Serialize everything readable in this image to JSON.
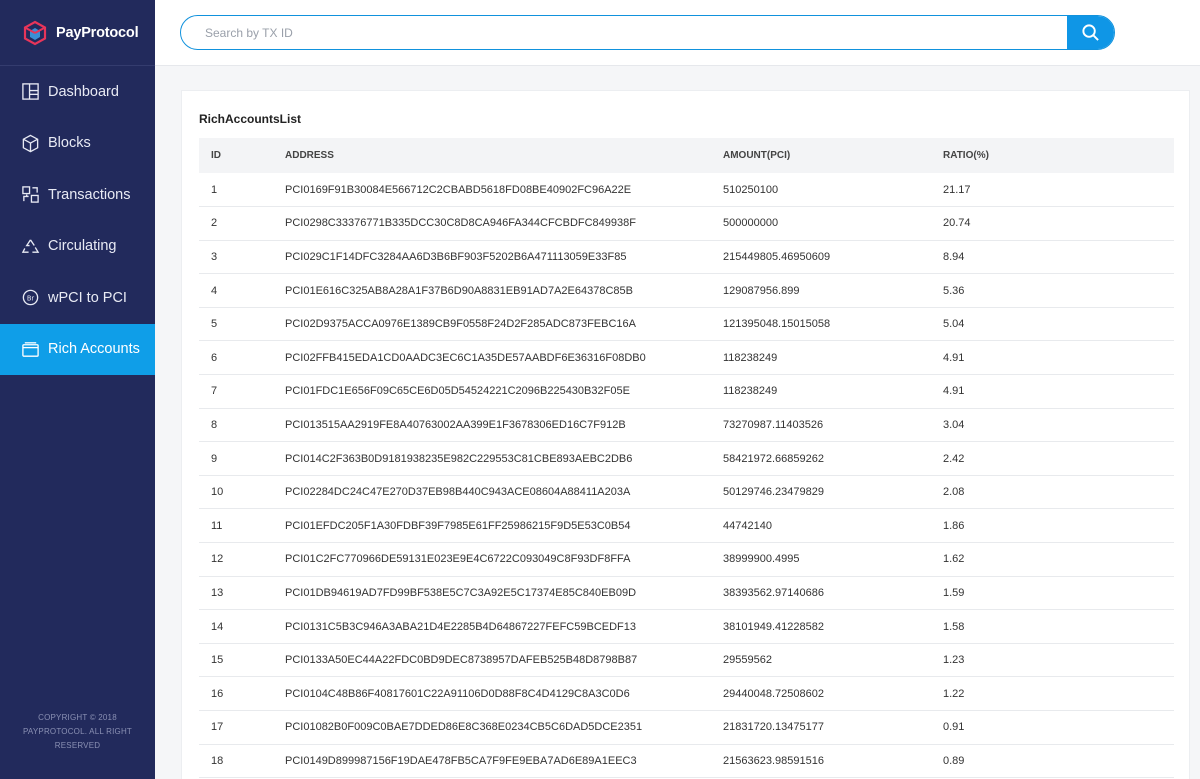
{
  "brand": {
    "name": "PayProtocol"
  },
  "sidebar": {
    "items": [
      {
        "label": "Dashboard",
        "icon": "dashboard-icon"
      },
      {
        "label": "Blocks",
        "icon": "cube-icon"
      },
      {
        "label": "Transactions",
        "icon": "transactions-icon"
      },
      {
        "label": "Circulating",
        "icon": "circulating-icon"
      },
      {
        "label": "wPCI to PCI",
        "icon": "coin-icon"
      },
      {
        "label": "Rich Accounts",
        "icon": "wallet-icon",
        "active": true
      }
    ],
    "copyright": [
      "COPYRIGHT © 2018",
      "PAYPROTOCOL. ALL RIGHT",
      "RESERVED"
    ]
  },
  "search": {
    "placeholder": "Search by TX ID",
    "value": ""
  },
  "main": {
    "title": "RichAccountsList",
    "columns": [
      "ID",
      "ADDRESS",
      "AMOUNT(PCI)",
      "RATIO(%)"
    ],
    "rows": [
      [
        "1",
        "PCI0169F91B30084E566712C2CBABD5618FD08BE40902FC96A22E",
        "510250100",
        "21.17"
      ],
      [
        "2",
        "PCI0298C33376771B335DCC30C8D8CA946FA344CFCBDFC849938F",
        "500000000",
        "20.74"
      ],
      [
        "3",
        "PCI029C1F14DFC3284AA6D3B6BF903F5202B6A471113059E33F85",
        "215449805.46950609",
        "8.94"
      ],
      [
        "4",
        "PCI01E616C325AB8A28A1F37B6D90A8831EB91AD7A2E64378C85B",
        "129087956.899",
        "5.36"
      ],
      [
        "5",
        "PCI02D9375ACCA0976E1389CB9F0558F24D2F285ADC873FEBC16A",
        "121395048.15015058",
        "5.04"
      ],
      [
        "6",
        "PCI02FFB415EDA1CD0AADC3EC6C1A35DE57AABDF6E36316F08DB0",
        "118238249",
        "4.91"
      ],
      [
        "7",
        "PCI01FDC1E656F09C65CE6D05D54524221C2096B225430B32F05E",
        "118238249",
        "4.91"
      ],
      [
        "8",
        "PCI013515AA2919FE8A40763002AA399E1F3678306ED16C7F912B",
        "73270987.11403526",
        "3.04"
      ],
      [
        "9",
        "PCI014C2F363B0D9181938235E982C229553C81CBE893AEBC2DB6",
        "58421972.66859262",
        "2.42"
      ],
      [
        "10",
        "PCI02284DC24C47E270D37EB98B440C943ACE08604A88411A203A",
        "50129746.23479829",
        "2.08"
      ],
      [
        "11",
        "PCI01EFDC205F1A30FDBF39F7985E61FF25986215F9D5E53C0B54",
        "44742140",
        "1.86"
      ],
      [
        "12",
        "PCI01C2FC770966DE59131E023E9E4C6722C093049C8F93DF8FFA",
        "38999900.4995",
        "1.62"
      ],
      [
        "13",
        "PCI01DB94619AD7FD99BF538E5C7C3A92E5C17374E85C840EB09D",
        "38393562.97140686",
        "1.59"
      ],
      [
        "14",
        "PCI0131C5B3C946A3ABA21D4E2285B4D64867227FEFC59BCEDF13",
        "38101949.41228582",
        "1.58"
      ],
      [
        "15",
        "PCI0133A50EC44A22FDC0BD9DEC8738957DAFEB525B48D8798B87",
        "29559562",
        "1.23"
      ],
      [
        "16",
        "PCI0104C48B86F40817601C22A91106D0D88F8C4D4129C8A3C0D6",
        "29440048.72508602",
        "1.22"
      ],
      [
        "17",
        "PCI01082B0F009C0BAE7DDED86E8C368E0234CB5C6DAD5DCE2351",
        "21831720.13475177",
        "0.91"
      ],
      [
        "18",
        "PCI0149D899987156F19DAE478FB5CA7F9FE9EBA7AD6E89A1EEC3",
        "21563623.98591516",
        "0.89"
      ]
    ]
  },
  "colors": {
    "sidebar": "#222a5c",
    "accent": "#0f9ee8"
  }
}
